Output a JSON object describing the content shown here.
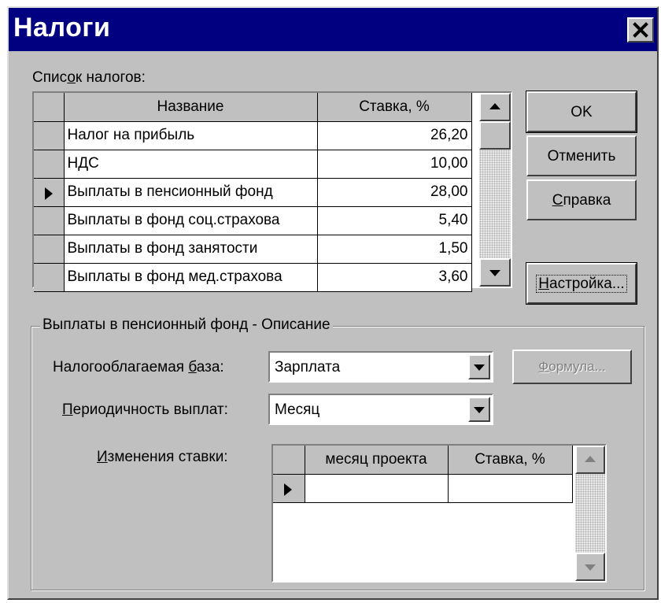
{
  "window": {
    "title": "Налоги"
  },
  "taxes_list": {
    "label_pre": "Спис",
    "label_acc": "о",
    "label_post": "к налогов:",
    "columns": {
      "name": "Название",
      "rate": "Ставка, %"
    },
    "rows": [
      {
        "name": "Налог на прибыль",
        "rate": "26,20",
        "current": false
      },
      {
        "name": "НДС",
        "rate": "10,00",
        "current": false
      },
      {
        "name": "Выплаты в пенсионный фонд",
        "rate": "28,00",
        "current": true
      },
      {
        "name": "Выплаты в фонд соц.страхова",
        "rate": "5,40",
        "current": false
      },
      {
        "name": "Выплаты в фонд занятости",
        "rate": "1,50",
        "current": false
      },
      {
        "name": "Выплаты в фонд мед.страхова",
        "rate": "3,60",
        "current": false
      }
    ]
  },
  "buttons": {
    "ok": "OK",
    "cancel": "Отменить",
    "help_acc": "С",
    "help_rest": "правка",
    "setup_acc": "Н",
    "setup_rest": "астройка..."
  },
  "description": {
    "title": "Выплаты в пенсионный фонд - Описание",
    "tax_base": {
      "label_pre": "Налогооблагаемая ",
      "label_acc": "б",
      "label_post": "аза:",
      "value": "Зарплата"
    },
    "formula": {
      "acc": "Ф",
      "rest": "ормула..."
    },
    "period": {
      "label_acc": "П",
      "label_rest": "ериодичность выплат:",
      "value": "Месяц"
    },
    "rate_changes": {
      "label_acc": "И",
      "label_rest": "зменения ставки:",
      "columns": {
        "month": "месяц проекта",
        "rate": "Ставка, %"
      }
    }
  }
}
